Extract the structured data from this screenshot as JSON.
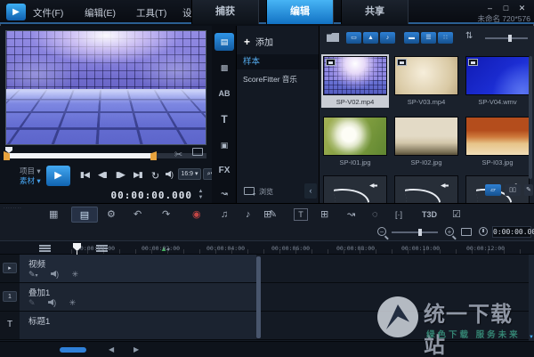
{
  "colors": {
    "accent": "#1f8fe8",
    "selection": "#c9cdd5",
    "trim_orange": "#e8a33d",
    "marker_green": "#3fae58",
    "watermark_green": "#3d9f86"
  },
  "titlebar": {
    "logo_glyph": "▶",
    "menus": [
      {
        "label": "文件(F)"
      },
      {
        "label": "编辑(E)"
      },
      {
        "label": "工具(T)"
      },
      {
        "label": "设置(S)"
      }
    ],
    "tabs": [
      {
        "label": "捕获"
      },
      {
        "label": "编辑",
        "active": true
      },
      {
        "label": "共享"
      }
    ],
    "controls": {
      "minimize": "–",
      "maximize": "□",
      "close": "✕"
    },
    "project_info": "未命名 720*576"
  },
  "preview": {
    "project_label": "项目",
    "clip_label": "素材",
    "aspect": "16:9",
    "timecode": "00:00:00.000",
    "transport": {
      "play": "▶",
      "home": "▮◀",
      "prev_frame": "◀▮",
      "next_frame": "▮▶",
      "end": "▶▮",
      "repeat": "↻"
    },
    "trim_scissors_glyph": "✂"
  },
  "library": {
    "nav": [
      {
        "name": "media",
        "glyph": "▤",
        "active": true
      },
      {
        "name": "instant-project",
        "glyph": "▩"
      },
      {
        "name": "transition",
        "glyph": "AB"
      },
      {
        "name": "title",
        "glyph": "T"
      },
      {
        "name": "graphic",
        "glyph": "▣"
      },
      {
        "name": "filter",
        "glyph": "FX"
      },
      {
        "name": "path",
        "glyph": "↝"
      }
    ],
    "add_label": "添加",
    "folders": [
      {
        "label": "样本",
        "selected": true
      },
      {
        "label": "ScoreFitter 音乐"
      }
    ],
    "browse_label": "浏览"
  },
  "media": {
    "toolbar_glyphs": {
      "video": "▭",
      "photo": "▲",
      "audio": "♪",
      "hide_titles": "▬",
      "list_view": "☰",
      "thumb_view": "∷",
      "sort": "⇅"
    },
    "items": [
      {
        "name": "SP-V02.mp4",
        "type": "video",
        "selected": true
      },
      {
        "name": "SP-V03.mp4",
        "type": "video"
      },
      {
        "name": "SP-V04.wmv",
        "type": "video"
      },
      {
        "name": "SP-I01.jpg",
        "type": "image"
      },
      {
        "name": "SP-I02.jpg",
        "type": "image"
      },
      {
        "name": "SP-I03.jpg",
        "type": "image"
      }
    ]
  },
  "toolbar": {
    "icons": [
      {
        "name": "storyboard-view",
        "glyph": "▦"
      },
      {
        "name": "timeline-view",
        "glyph": "▤",
        "active": true
      },
      {
        "name": "settings-tool",
        "glyph": "⚙"
      },
      {
        "name": "undo",
        "glyph": "↶"
      },
      {
        "name": "redo",
        "glyph": "↷"
      },
      {
        "name": "record-capture",
        "glyph": "◉"
      },
      {
        "name": "sound-mixer",
        "glyph": "♫"
      },
      {
        "name": "auto-music",
        "glyph": "♪"
      },
      {
        "name": "painting-creator",
        "glyph": "✎"
      },
      {
        "name": "subtitle-editor",
        "glyph": "T"
      },
      {
        "name": "multicam-editor",
        "glyph": "⊞"
      },
      {
        "name": "motion-tracking",
        "glyph": "↝"
      },
      {
        "name": "mask-creator",
        "glyph": "◌"
      },
      {
        "name": "region-select",
        "glyph": "[·]"
      },
      {
        "name": "title-3d",
        "glyph": "T3D"
      },
      {
        "name": "batch-tool",
        "glyph": "☑"
      }
    ]
  },
  "timeline": {
    "timecode": "0:00:00.000",
    "ruler_labels": [
      "00:00:00:00",
      "00:00:02:00",
      "00:00:04:00",
      "00:00:06:00",
      "00:00:08:00",
      "00:00:10:00",
      "00:00:12:00"
    ],
    "tracks": [
      {
        "name": "视频",
        "icon": "▸"
      },
      {
        "name": "叠加1",
        "icon": "1"
      },
      {
        "name": "标题1",
        "icon": "T"
      }
    ]
  },
  "watermark": {
    "title": "统一下载站",
    "subtitle": "绿色下载 服务未来"
  }
}
